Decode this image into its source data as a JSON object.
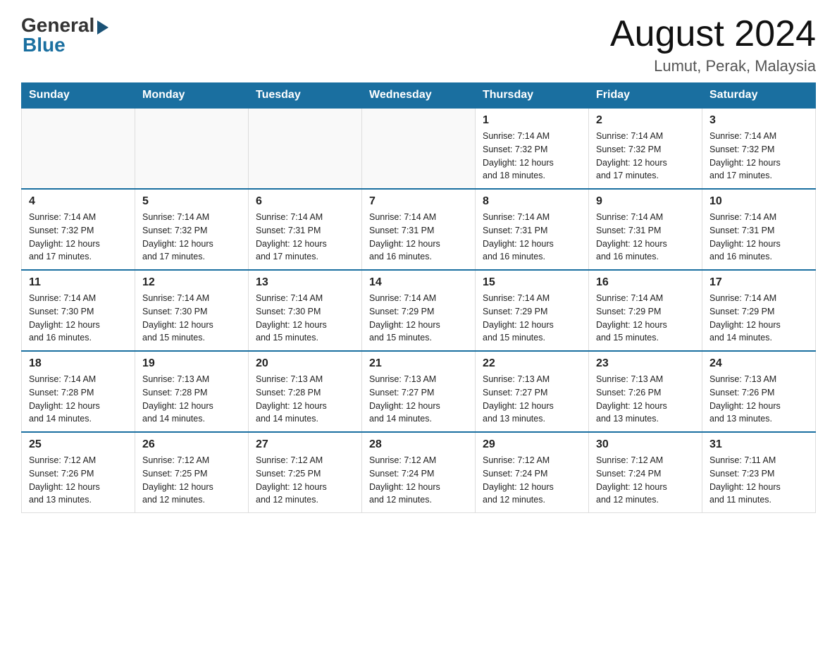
{
  "header": {
    "logo_general": "General",
    "logo_blue": "Blue",
    "month_year": "August 2024",
    "location": "Lumut, Perak, Malaysia"
  },
  "weekdays": [
    "Sunday",
    "Monday",
    "Tuesday",
    "Wednesday",
    "Thursday",
    "Friday",
    "Saturday"
  ],
  "weeks": [
    [
      {
        "day": "",
        "info": ""
      },
      {
        "day": "",
        "info": ""
      },
      {
        "day": "",
        "info": ""
      },
      {
        "day": "",
        "info": ""
      },
      {
        "day": "1",
        "info": "Sunrise: 7:14 AM\nSunset: 7:32 PM\nDaylight: 12 hours\nand 18 minutes."
      },
      {
        "day": "2",
        "info": "Sunrise: 7:14 AM\nSunset: 7:32 PM\nDaylight: 12 hours\nand 17 minutes."
      },
      {
        "day": "3",
        "info": "Sunrise: 7:14 AM\nSunset: 7:32 PM\nDaylight: 12 hours\nand 17 minutes."
      }
    ],
    [
      {
        "day": "4",
        "info": "Sunrise: 7:14 AM\nSunset: 7:32 PM\nDaylight: 12 hours\nand 17 minutes."
      },
      {
        "day": "5",
        "info": "Sunrise: 7:14 AM\nSunset: 7:32 PM\nDaylight: 12 hours\nand 17 minutes."
      },
      {
        "day": "6",
        "info": "Sunrise: 7:14 AM\nSunset: 7:31 PM\nDaylight: 12 hours\nand 17 minutes."
      },
      {
        "day": "7",
        "info": "Sunrise: 7:14 AM\nSunset: 7:31 PM\nDaylight: 12 hours\nand 16 minutes."
      },
      {
        "day": "8",
        "info": "Sunrise: 7:14 AM\nSunset: 7:31 PM\nDaylight: 12 hours\nand 16 minutes."
      },
      {
        "day": "9",
        "info": "Sunrise: 7:14 AM\nSunset: 7:31 PM\nDaylight: 12 hours\nand 16 minutes."
      },
      {
        "day": "10",
        "info": "Sunrise: 7:14 AM\nSunset: 7:31 PM\nDaylight: 12 hours\nand 16 minutes."
      }
    ],
    [
      {
        "day": "11",
        "info": "Sunrise: 7:14 AM\nSunset: 7:30 PM\nDaylight: 12 hours\nand 16 minutes."
      },
      {
        "day": "12",
        "info": "Sunrise: 7:14 AM\nSunset: 7:30 PM\nDaylight: 12 hours\nand 15 minutes."
      },
      {
        "day": "13",
        "info": "Sunrise: 7:14 AM\nSunset: 7:30 PM\nDaylight: 12 hours\nand 15 minutes."
      },
      {
        "day": "14",
        "info": "Sunrise: 7:14 AM\nSunset: 7:29 PM\nDaylight: 12 hours\nand 15 minutes."
      },
      {
        "day": "15",
        "info": "Sunrise: 7:14 AM\nSunset: 7:29 PM\nDaylight: 12 hours\nand 15 minutes."
      },
      {
        "day": "16",
        "info": "Sunrise: 7:14 AM\nSunset: 7:29 PM\nDaylight: 12 hours\nand 15 minutes."
      },
      {
        "day": "17",
        "info": "Sunrise: 7:14 AM\nSunset: 7:29 PM\nDaylight: 12 hours\nand 14 minutes."
      }
    ],
    [
      {
        "day": "18",
        "info": "Sunrise: 7:14 AM\nSunset: 7:28 PM\nDaylight: 12 hours\nand 14 minutes."
      },
      {
        "day": "19",
        "info": "Sunrise: 7:13 AM\nSunset: 7:28 PM\nDaylight: 12 hours\nand 14 minutes."
      },
      {
        "day": "20",
        "info": "Sunrise: 7:13 AM\nSunset: 7:28 PM\nDaylight: 12 hours\nand 14 minutes."
      },
      {
        "day": "21",
        "info": "Sunrise: 7:13 AM\nSunset: 7:27 PM\nDaylight: 12 hours\nand 14 minutes."
      },
      {
        "day": "22",
        "info": "Sunrise: 7:13 AM\nSunset: 7:27 PM\nDaylight: 12 hours\nand 13 minutes."
      },
      {
        "day": "23",
        "info": "Sunrise: 7:13 AM\nSunset: 7:26 PM\nDaylight: 12 hours\nand 13 minutes."
      },
      {
        "day": "24",
        "info": "Sunrise: 7:13 AM\nSunset: 7:26 PM\nDaylight: 12 hours\nand 13 minutes."
      }
    ],
    [
      {
        "day": "25",
        "info": "Sunrise: 7:12 AM\nSunset: 7:26 PM\nDaylight: 12 hours\nand 13 minutes."
      },
      {
        "day": "26",
        "info": "Sunrise: 7:12 AM\nSunset: 7:25 PM\nDaylight: 12 hours\nand 12 minutes."
      },
      {
        "day": "27",
        "info": "Sunrise: 7:12 AM\nSunset: 7:25 PM\nDaylight: 12 hours\nand 12 minutes."
      },
      {
        "day": "28",
        "info": "Sunrise: 7:12 AM\nSunset: 7:24 PM\nDaylight: 12 hours\nand 12 minutes."
      },
      {
        "day": "29",
        "info": "Sunrise: 7:12 AM\nSunset: 7:24 PM\nDaylight: 12 hours\nand 12 minutes."
      },
      {
        "day": "30",
        "info": "Sunrise: 7:12 AM\nSunset: 7:24 PM\nDaylight: 12 hours\nand 12 minutes."
      },
      {
        "day": "31",
        "info": "Sunrise: 7:11 AM\nSunset: 7:23 PM\nDaylight: 12 hours\nand 11 minutes."
      }
    ]
  ]
}
